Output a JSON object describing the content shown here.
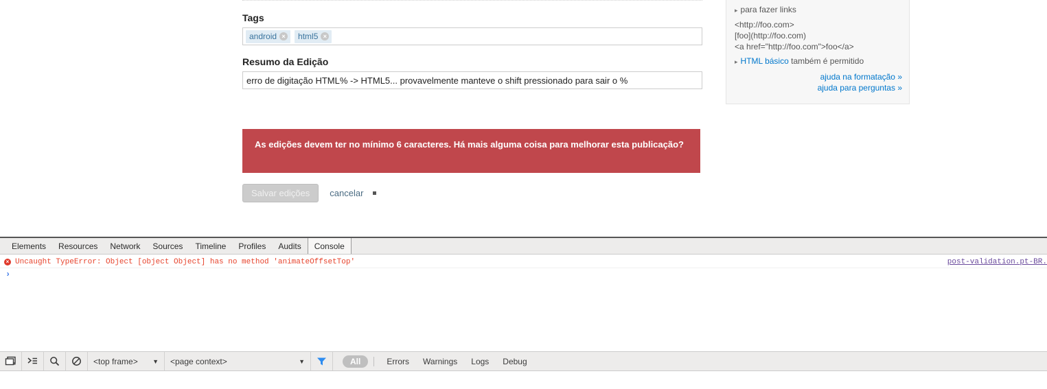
{
  "page": {
    "tags_field": {
      "label": "Tags",
      "tags": [
        {
          "name": "android",
          "remove_icon": "close-icon",
          "remove_glyph": "×"
        },
        {
          "name": "html5",
          "remove_icon": "close-icon",
          "remove_glyph": "×"
        }
      ]
    },
    "summary_field": {
      "label": "Resumo da Edição",
      "value": "erro de digitação HTML% -> HTML5... provavelmente manteve o shift pressionado para sair o %",
      "placeholder": ""
    },
    "error_banner": {
      "text": "As edições devem ter no mínimo 6 caracteres. Há mais alguma coisa para melhorar esta publicação?",
      "color": "#c0474c"
    },
    "actions": {
      "save_label": "Salvar edições",
      "cancel_label": "cancelar",
      "save_disabled": true
    }
  },
  "help_panel": {
    "link_hint": {
      "arrow": "▸",
      "text": "para fazer links"
    },
    "code_lines": [
      "<http://foo.com>",
      "[foo](http://foo.com)",
      "<a href=\"http://foo.com\">foo</a>"
    ],
    "html_hint": {
      "arrow": "▸",
      "link_text": "HTML básico",
      "rest_text": " também é permitido"
    },
    "footer_links": [
      "ajuda na formatação »",
      "ajuda para perguntas »"
    ],
    "link_color": "#0077cc"
  },
  "devtools": {
    "tabs": [
      {
        "label": "Elements",
        "active": false
      },
      {
        "label": "Resources",
        "active": false
      },
      {
        "label": "Network",
        "active": false
      },
      {
        "label": "Sources",
        "active": false
      },
      {
        "label": "Timeline",
        "active": false
      },
      {
        "label": "Profiles",
        "active": false
      },
      {
        "label": "Audits",
        "active": false
      },
      {
        "label": "Console",
        "active": true
      }
    ],
    "console": {
      "messages": [
        {
          "level": "error",
          "icon": "error-icon",
          "icon_glyph": "×",
          "text": "Uncaught TypeError: Object [object Object] has no method 'animateOffsetTop'",
          "source": "post-validation.pt-BR."
        }
      ],
      "prompt_glyph": "›",
      "error_color": "#e7432c"
    },
    "bottom_bar": {
      "dock_icon": "dock-panel-icon",
      "console_drawer_icon": "console-drawer-icon",
      "search_icon": "search-icon",
      "clear_icon": "clear-console-icon",
      "frame_select": {
        "value": "<top frame>",
        "caret": "▼"
      },
      "context_select": {
        "value": "<page context>",
        "caret": "▼"
      },
      "filter_icon": "funnel-filter-icon",
      "filters": [
        {
          "label": "All",
          "active": true
        },
        {
          "label": "Errors",
          "active": false
        },
        {
          "label": "Warnings",
          "active": false
        },
        {
          "label": "Logs",
          "active": false
        },
        {
          "label": "Debug",
          "active": false
        }
      ]
    }
  }
}
